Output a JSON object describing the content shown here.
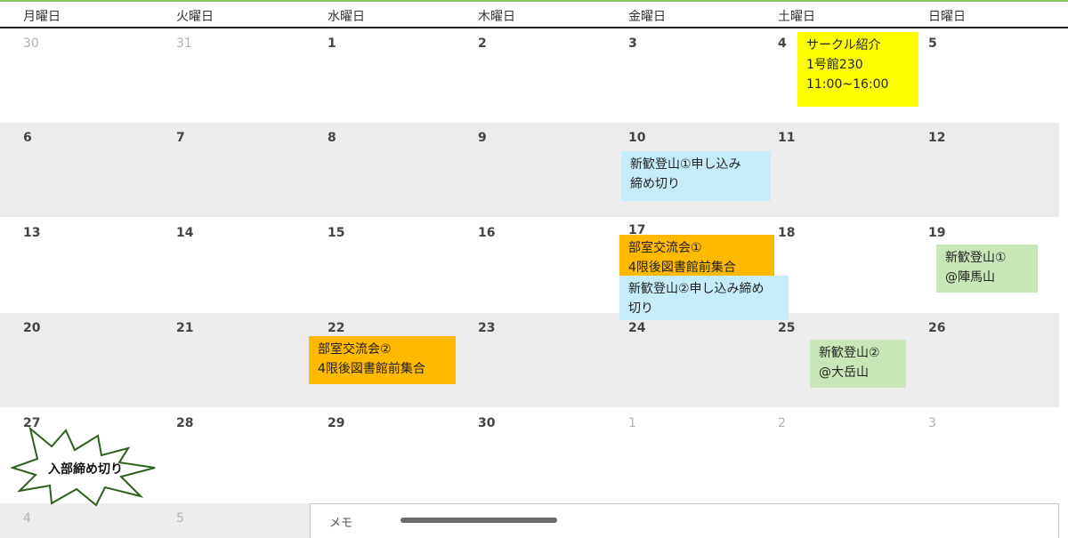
{
  "weekdays": [
    "月曜日",
    "火曜日",
    "水曜日",
    "木曜日",
    "金曜日",
    "土曜日",
    "日曜日"
  ],
  "weeks": [
    {
      "days": [
        "30",
        "31",
        "1",
        "2",
        "3",
        "4",
        "5"
      ]
    },
    {
      "days": [
        "6",
        "7",
        "8",
        "9",
        "10",
        "11",
        "12"
      ]
    },
    {
      "days": [
        "13",
        "14",
        "15",
        "16",
        "17",
        "18",
        "19"
      ]
    },
    {
      "days": [
        "20",
        "21",
        "22",
        "23",
        "24",
        "25",
        "26"
      ]
    },
    {
      "days": [
        "27",
        "28",
        "29",
        "30",
        "1",
        "2",
        "3"
      ]
    },
    {
      "days": [
        "4",
        "5"
      ]
    }
  ],
  "events": {
    "circle_intro": {
      "line1": "サークル紹介",
      "line2": "1号館230",
      "line3": "11:00~16:00"
    },
    "hike1_deadline": {
      "line1": "新歓登山①申し込み",
      "line2": "締め切り"
    },
    "club_meet1": {
      "line1": "部室交流会①",
      "line2": "4限後図書館前集合"
    },
    "hike2_deadline": {
      "line1": "新歓登山②申し込み締め",
      "line2": "切り"
    },
    "hike1": {
      "line1": "新歓登山①",
      "line2": "@陣馬山"
    },
    "club_meet2": {
      "line1": "部室交流会②",
      "line2": "4限後図書館前集合"
    },
    "hike2": {
      "line1": "新歓登山②",
      "line2": "@大岳山"
    }
  },
  "join_deadline": "入部締め切り",
  "memo": {
    "label": "メモ"
  },
  "colors": {
    "header_accent": "#8dc96b",
    "yellow": "#ffff00",
    "blue": "#c6ecfa",
    "orange": "#ffb900",
    "green": "#c9e6b9",
    "shaded_row": "#ececec"
  }
}
